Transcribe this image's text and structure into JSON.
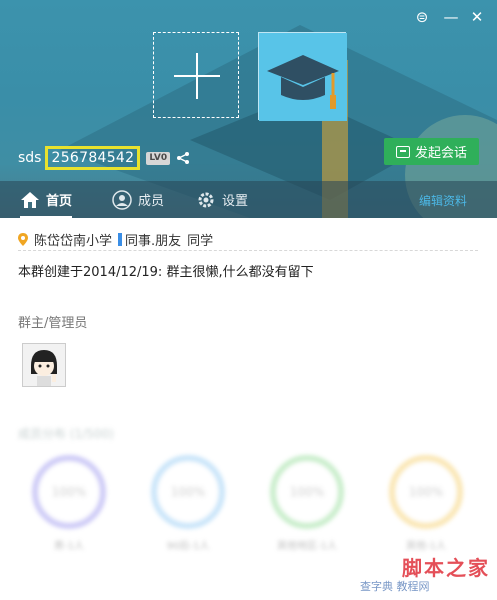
{
  "header": {
    "group_name": "sds",
    "group_number": "256784542",
    "level": "LV0",
    "start_chat_label": "发起会话"
  },
  "tabs": [
    {
      "label": "首页"
    },
    {
      "label": "成员"
    },
    {
      "label": "设置"
    }
  ],
  "edit_link": "编辑资料",
  "info": {
    "location": "陈岱岱南小学",
    "tag": "同事.朋友",
    "tag_extra": "同学",
    "intro": "本群创建于2014/12/19:  群主很懒,什么都没有留下"
  },
  "admins": {
    "title": "群主/管理员"
  },
  "stats": {
    "title": "成员分布 (1/500)",
    "rings": [
      {
        "value": "100%",
        "label": "男-1人",
        "color": "#a7a2f0"
      },
      {
        "value": "100%",
        "label": "90后-1人",
        "color": "#9fd0f5"
      },
      {
        "value": "100%",
        "label": "其他地区-1人",
        "color": "#9fe0a3"
      },
      {
        "value": "100%",
        "label": "其他-1人",
        "color": "#f6d37a"
      }
    ]
  },
  "watermark": {
    "big": "脚本之家",
    "small": "查字典 教程网"
  },
  "colors": {
    "banner": "#3c93ad",
    "start_chat": "#2faf5a",
    "highlight_box": "#e8e22d",
    "edit_link": "#4cb8e6"
  }
}
